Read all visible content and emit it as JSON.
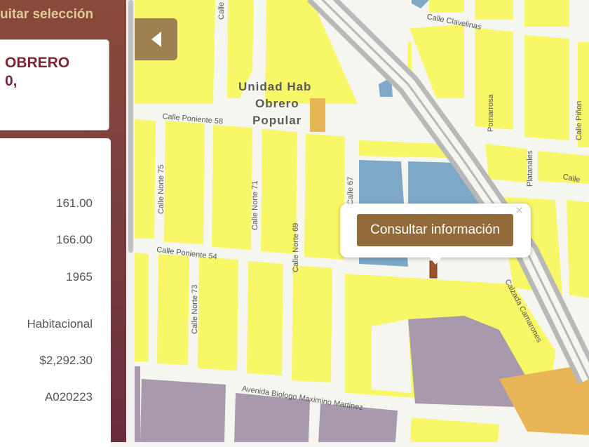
{
  "sidebar": {
    "header_text": "uitar selección",
    "title_lines": [
      "OBRERO",
      "0,"
    ],
    "values": [
      "161.00",
      "166.00",
      "1965",
      "Habitacional",
      "$2,292.30",
      "A020223"
    ]
  },
  "map": {
    "popup": {
      "button_label": "Consultar información",
      "close_glyph": "×"
    },
    "poi": [
      "Unidad Hab",
      "Obrero",
      "Popular"
    ],
    "streets": {
      "calle_clavelinas": "Calle Clavelinas",
      "pomarrosa": "Pomarrosa",
      "calle_pinon": "Calle Piñon",
      "platanales": "Platanales",
      "calle_right": "Calle",
      "calle_poniente_58": "Calle Poniente 58",
      "calle_poniente_54": "Calle Poniente 54",
      "calle_norte_75": "Calle Norte 75",
      "calle_norte_71": "Calle Norte 71",
      "calle_norte_69": "Calle Norte 69",
      "calle_norte_73": "Calle Norte 73",
      "calle_67": "Calle 67",
      "calzada_camarones": "Calzada Camarones",
      "avenida_biologo": "Avenida Biologo Maximino Martinez",
      "calle_top": "Calle"
    }
  },
  "colors": {
    "sidebar_gradient": [
      "#8a4a3a",
      "#6a2c3c"
    ],
    "header_text": "#e0c89a",
    "title_text": "#7a2636",
    "block_yellow": "#f8f768",
    "block_orange": "#e8b656",
    "block_blue": "#7ea8c8",
    "block_purple": "#a89aac",
    "road": "#f6f6f0",
    "highway": "#b8b8b8",
    "button_brown": "#936a3a",
    "collapse_tab": "#a08151"
  }
}
